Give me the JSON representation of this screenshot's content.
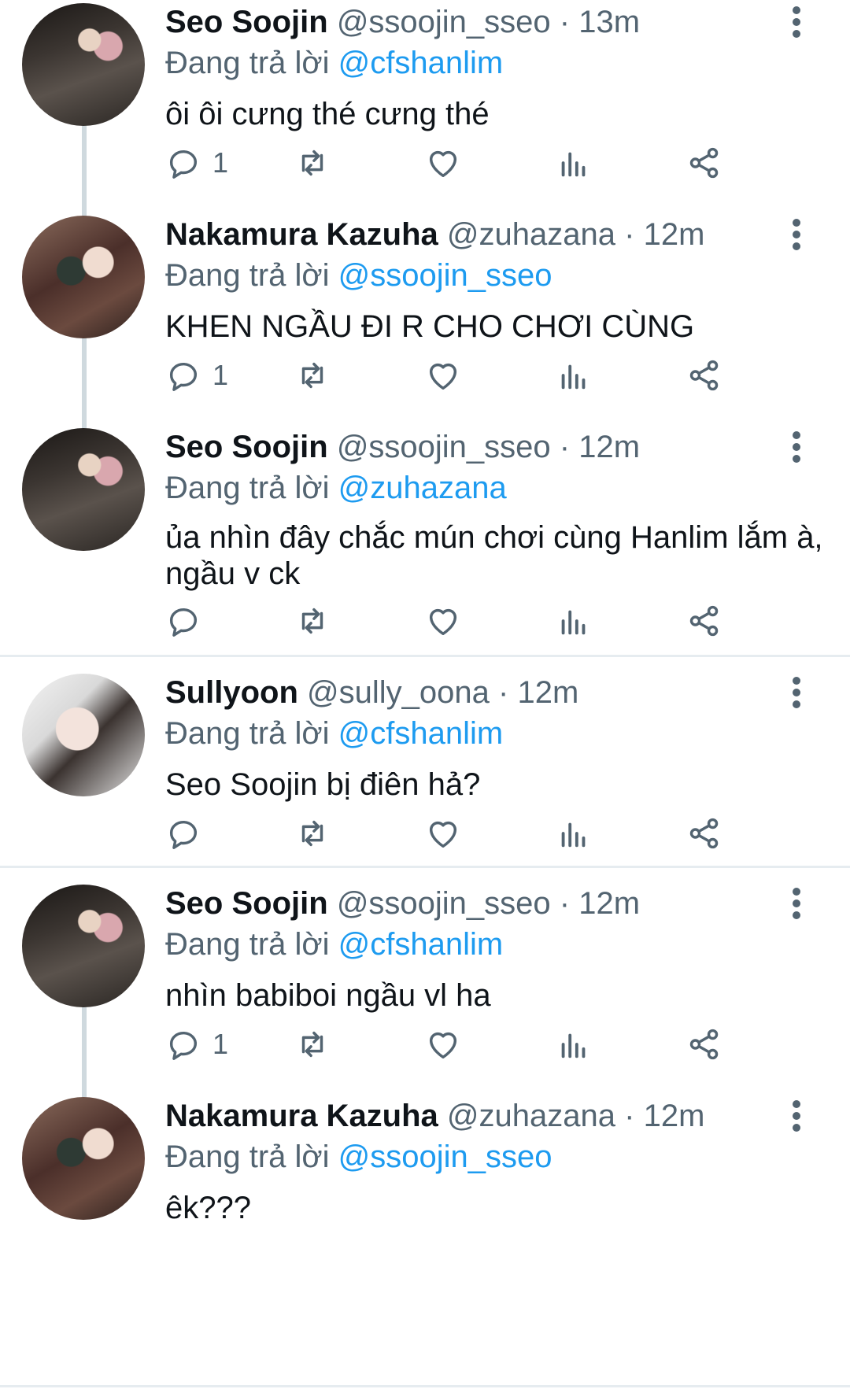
{
  "labels": {
    "replying_prefix": "Đang trả lời"
  },
  "tweets": [
    {
      "name": "Seo Soojin",
      "handle": "@ssoojin_sseo",
      "dot": "·",
      "time": "13m",
      "reply_to": "@cfshanlim",
      "text": "ôi ôi cưng thé cưng thé",
      "reply_count": "1",
      "avatar_icon": "profile-photo"
    },
    {
      "name": "Nakamura Kazuha",
      "handle": "@zuhazana",
      "dot": "·",
      "time": "12m",
      "reply_to": "@ssoojin_sseo",
      "text": "KHEN NGẦU ĐI R CHO CHƠI CÙNG",
      "reply_count": "1",
      "avatar_icon": "profile-photo"
    },
    {
      "name": "Seo Soojin",
      "handle": "@ssoojin_sseo",
      "dot": "·",
      "time": "12m",
      "reply_to": "@zuhazana",
      "text": "ủa nhìn đây chắc mún chơi cùng Hanlim lắm à, ngầu v ck",
      "reply_count": "",
      "avatar_icon": "profile-photo"
    },
    {
      "name": "Sullyoon",
      "handle": "@sully_oona",
      "dot": "·",
      "time": "12m",
      "reply_to": "@cfshanlim",
      "text": "Seo Soojin bị điên hả?",
      "reply_count": "",
      "avatar_icon": "profile-photo"
    },
    {
      "name": "Seo Soojin",
      "handle": "@ssoojin_sseo",
      "dot": "·",
      "time": "12m",
      "reply_to": "@cfshanlim",
      "text": "nhìn babiboi ngầu vl ha",
      "reply_count": "1",
      "avatar_icon": "profile-photo"
    },
    {
      "name": "Nakamura Kazuha",
      "handle": "@zuhazana",
      "dot": "·",
      "time": "12m",
      "reply_to": "@ssoojin_sseo",
      "text": "êk???",
      "reply_count": "",
      "avatar_icon": "profile-photo"
    }
  ],
  "colors": {
    "mention": "#1d9bf0",
    "secondary": "#536471",
    "thread_line": "#cfd9de"
  }
}
